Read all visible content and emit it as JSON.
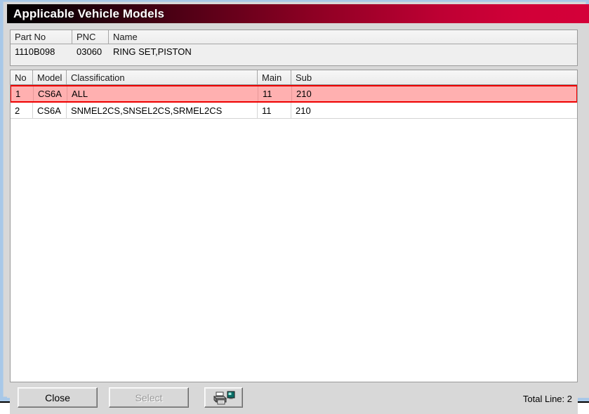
{
  "window": {
    "title": "Applicable Vehicle Models"
  },
  "part_info": {
    "columns": [
      "Part No",
      "PNC",
      "Name"
    ],
    "row": {
      "part_no": "1110B098",
      "pnc": "03060",
      "name": "RING SET,PISTON"
    }
  },
  "models_grid": {
    "columns": [
      "No",
      "Model",
      "Classification",
      "Main",
      "Sub"
    ],
    "rows": [
      {
        "no": "1",
        "model": "CS6A",
        "classification": "ALL",
        "main": "11",
        "sub": "210",
        "selected": true
      },
      {
        "no": "2",
        "model": "CS6A",
        "classification": "SNMEL2CS,SNSEL2CS,SRMEL2CS",
        "main": "11",
        "sub": "210",
        "selected": false
      }
    ]
  },
  "toolbar": {
    "close_label": "Close",
    "select_label": "Select",
    "select_enabled": false,
    "print_icon": "printer-icon",
    "total_line_label": "Total Line: 2"
  },
  "colors": {
    "title_gradient_start": "#000000",
    "title_gradient_end": "#d40039",
    "selection_fill": "#ffb0b0",
    "selection_border": "#ee0000",
    "window_frame": "#a8c8e8",
    "dialog_face": "#d8d8d8"
  }
}
